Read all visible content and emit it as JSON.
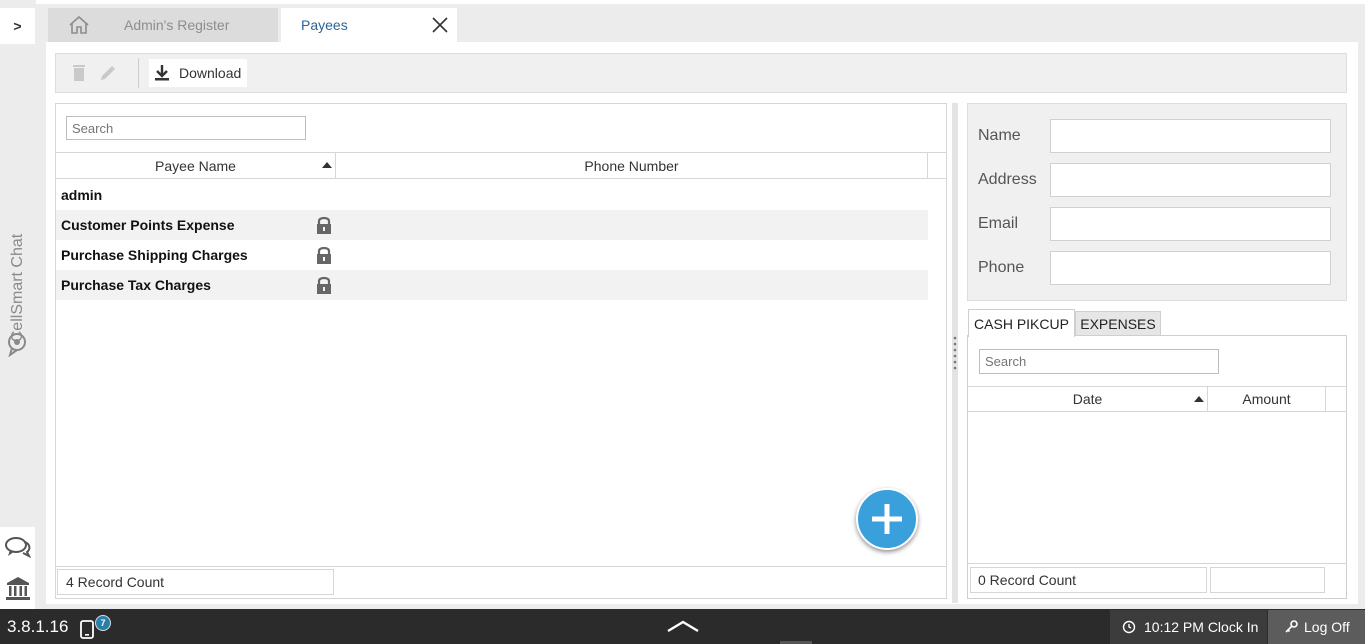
{
  "left_rail": {
    "toggle_label": ">",
    "chat_label": "CellSmart Chat",
    "icons": [
      "chat-bubbles-icon",
      "bank-icon"
    ]
  },
  "tabs": {
    "home_icon": "home-icon",
    "register_label": "Admin's Register",
    "payees_label": "Payees",
    "close_icon": "close-icon"
  },
  "toolbar": {
    "delete_icon": "trash-icon",
    "edit_icon": "pencil-icon",
    "download_label": "Download",
    "download_icon": "download-icon"
  },
  "payee_list": {
    "search_placeholder": "Search",
    "columns": [
      "Payee Name",
      "Phone Number"
    ],
    "sort_column": "Payee Name",
    "sort_direction": "ascending",
    "rows": [
      {
        "name": "admin",
        "phone": "",
        "locked": false
      },
      {
        "name": "Customer Points Expense",
        "phone": "",
        "locked": true
      },
      {
        "name": "Purchase Shipping Charges",
        "phone": "",
        "locked": true
      },
      {
        "name": "Purchase Tax Charges",
        "phone": "",
        "locked": true
      }
    ],
    "record_count": "4 Record Count",
    "add_icon": "plus-icon"
  },
  "detail_form": {
    "name_label": "Name",
    "name_value": "",
    "address_label": "Address",
    "address_value": "",
    "email_label": "Email",
    "email_value": "",
    "phone_label": "Phone",
    "phone_value": ""
  },
  "sub_tabs": {
    "active": "CASH PIKCUP",
    "items": [
      "CASH PIKCUP",
      "EXPENSES"
    ]
  },
  "transactions": {
    "search_placeholder": "Search",
    "columns": [
      "Date",
      "Amount"
    ],
    "sort_column": "Date",
    "rows": [],
    "record_count": "0 Record Count"
  },
  "status_bar": {
    "version": "3.8.1.16",
    "device_badge": "7",
    "clock_text": "10:12 PM Clock In",
    "logoff_text": "Log Off",
    "bg_color": "#2b2b2b"
  },
  "colors": {
    "accent": "#3aa0dc",
    "active_tab_text": "#2a6496"
  }
}
